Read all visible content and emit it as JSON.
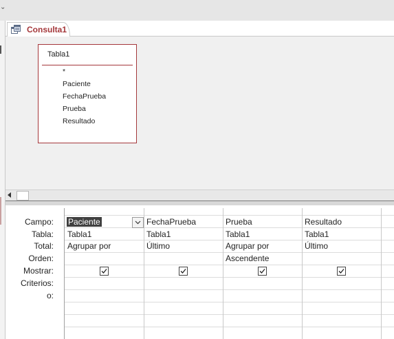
{
  "window": {
    "tab_title": "Consulta1"
  },
  "table_box": {
    "title": "Tabla1",
    "fields": [
      "*",
      "Paciente",
      "FechaPrueba",
      "Prueba",
      "Resultado"
    ]
  },
  "grid": {
    "row_labels": {
      "campo": "Campo:",
      "tabla": "Tabla:",
      "total": "Total:",
      "orden": "Orden:",
      "mostrar": "Mostrar:",
      "criterios": "Criterios:",
      "o": "o:"
    },
    "columns": [
      {
        "campo": "Paciente",
        "tabla": "Tabla1",
        "total": "Agrupar por",
        "orden": "",
        "mostrar": true
      },
      {
        "campo": "FechaPrueba",
        "tabla": "Tabla1",
        "total": "Último",
        "orden": "",
        "mostrar": true
      },
      {
        "campo": "Prueba",
        "tabla": "Tabla1",
        "total": "Agrupar por",
        "orden": "Ascendente",
        "mostrar": true
      },
      {
        "campo": "Resultado",
        "tabla": "Tabla1",
        "total": "Último",
        "orden": "",
        "mostrar": true
      }
    ]
  },
  "colors": {
    "accent": "#a4373a",
    "selection": "#404040"
  }
}
